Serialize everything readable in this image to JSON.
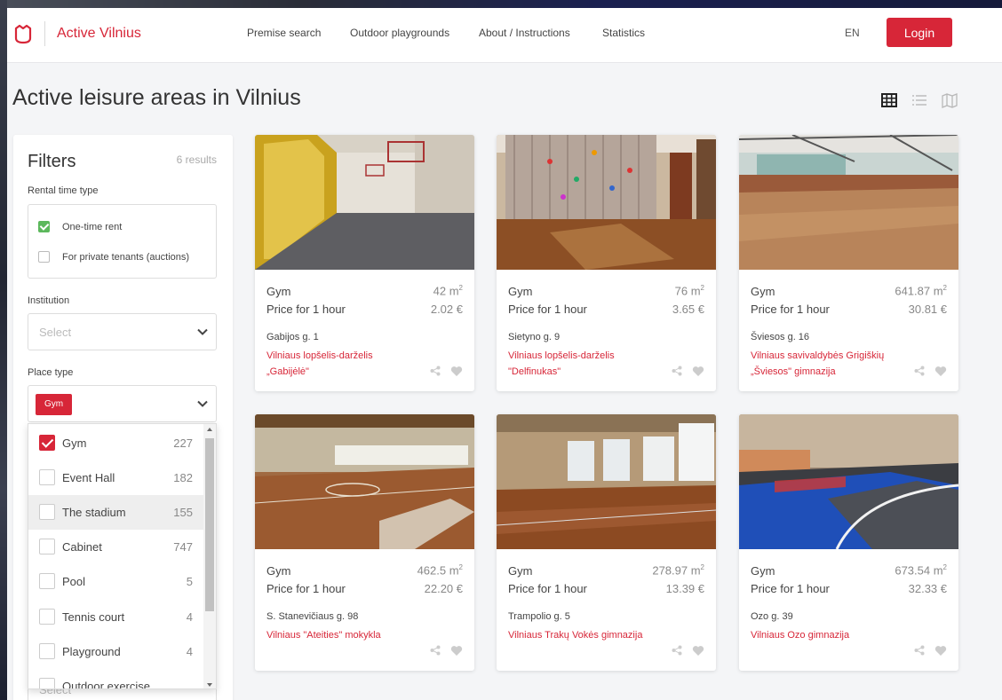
{
  "header": {
    "brand": "Active Vilnius",
    "nav": [
      "Premise search",
      "Outdoor playgrounds",
      "About / Instructions",
      "Statistics"
    ],
    "language": "EN",
    "login_label": "Login"
  },
  "page_title": "Active leisure areas in Vilnius",
  "filters": {
    "title": "Filters",
    "results": "6 results",
    "rental_label": "Rental time type",
    "rental_options": [
      {
        "label": "One-time rent",
        "checked": true
      },
      {
        "label": "For private tenants (auctions)",
        "checked": false
      }
    ],
    "institution_label": "Institution",
    "institution_placeholder": "Select",
    "place_type_label": "Place type",
    "place_type_tag": "Gym",
    "next_select_placeholder": "Select",
    "place_types": [
      {
        "label": "Gym",
        "count": "227",
        "checked": true
      },
      {
        "label": "Event Hall",
        "count": "182",
        "checked": false
      },
      {
        "label": "The stadium",
        "count": "155",
        "checked": false
      },
      {
        "label": "Cabinet",
        "count": "747",
        "checked": false
      },
      {
        "label": "Pool",
        "count": "5",
        "checked": false
      },
      {
        "label": "Tennis court",
        "count": "4",
        "checked": false
      },
      {
        "label": "Playground",
        "count": "4",
        "checked": false
      },
      {
        "label": "Outdoor exercise",
        "count": "",
        "checked": false
      }
    ]
  },
  "cards": [
    {
      "type": "Gym",
      "area": "42 m",
      "price_label": "Price for 1 hour",
      "price": "2.02 €",
      "address": "Gabijos g. 1",
      "institution": "Vilniaus lopšelis-darželis „Gabijėlė\""
    },
    {
      "type": "Gym",
      "area": "76 m",
      "price_label": "Price for 1 hour",
      "price": "3.65 €",
      "address": "Sietyno g. 9",
      "institution": "Vilniaus lopšelis-darželis \"Delfinukas\""
    },
    {
      "type": "Gym",
      "area": "641.87 m",
      "price_label": "Price for 1 hour",
      "price": "30.81 €",
      "address": "Šviesos g. 16",
      "institution": "Vilniaus savivaldybės Grigiškių „Šviesos\" gimnazija"
    },
    {
      "type": "Gym",
      "area": "462.5 m",
      "price_label": "Price for 1 hour",
      "price": "22.20 €",
      "address": "S. Stanevičiaus g. 98",
      "institution": "Vilniaus \"Ateities\" mokykla"
    },
    {
      "type": "Gym",
      "area": "278.97 m",
      "price_label": "Price for 1 hour",
      "price": "13.39 €",
      "address": "Trampolio g. 5",
      "institution": "Vilniaus Trakų Vokės gimnazija"
    },
    {
      "type": "Gym",
      "area": "673.54 m",
      "price_label": "Price for 1 hour",
      "price": "32.33 €",
      "address": "Ozo g. 39",
      "institution": "Vilniaus Ozo gimnazija"
    }
  ],
  "area_unit_sup": "2",
  "colors": {
    "accent": "#d72638",
    "check_green": "#5cb85c",
    "background": "#f4f5f7"
  },
  "icons": [
    "logo-icon",
    "grid-view-icon",
    "list-view-icon",
    "map-view-icon",
    "chevron-down-icon",
    "share-icon",
    "heart-icon"
  ]
}
